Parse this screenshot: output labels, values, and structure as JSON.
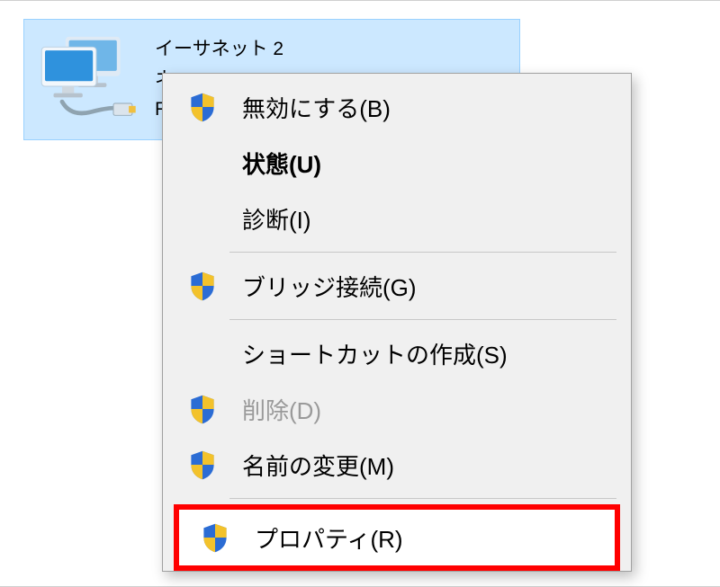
{
  "adapter": {
    "name": "イーサネット 2",
    "line2_partial": "ネ",
    "line3_partial": "R"
  },
  "menu": {
    "items": [
      {
        "label": "無効にする(B)",
        "shield": true
      },
      {
        "label": "状態(U)",
        "bold": true
      },
      {
        "label": "診断(I)"
      }
    ],
    "group2": [
      {
        "label": "ブリッジ接続(G)",
        "shield": true
      }
    ],
    "group3": [
      {
        "label": "ショートカットの作成(S)"
      },
      {
        "label": "削除(D)",
        "shield": true,
        "disabled": true
      },
      {
        "label": "名前の変更(M)",
        "shield": true
      }
    ],
    "highlighted": {
      "label": "プロパティ(R)",
      "shield": true
    }
  }
}
